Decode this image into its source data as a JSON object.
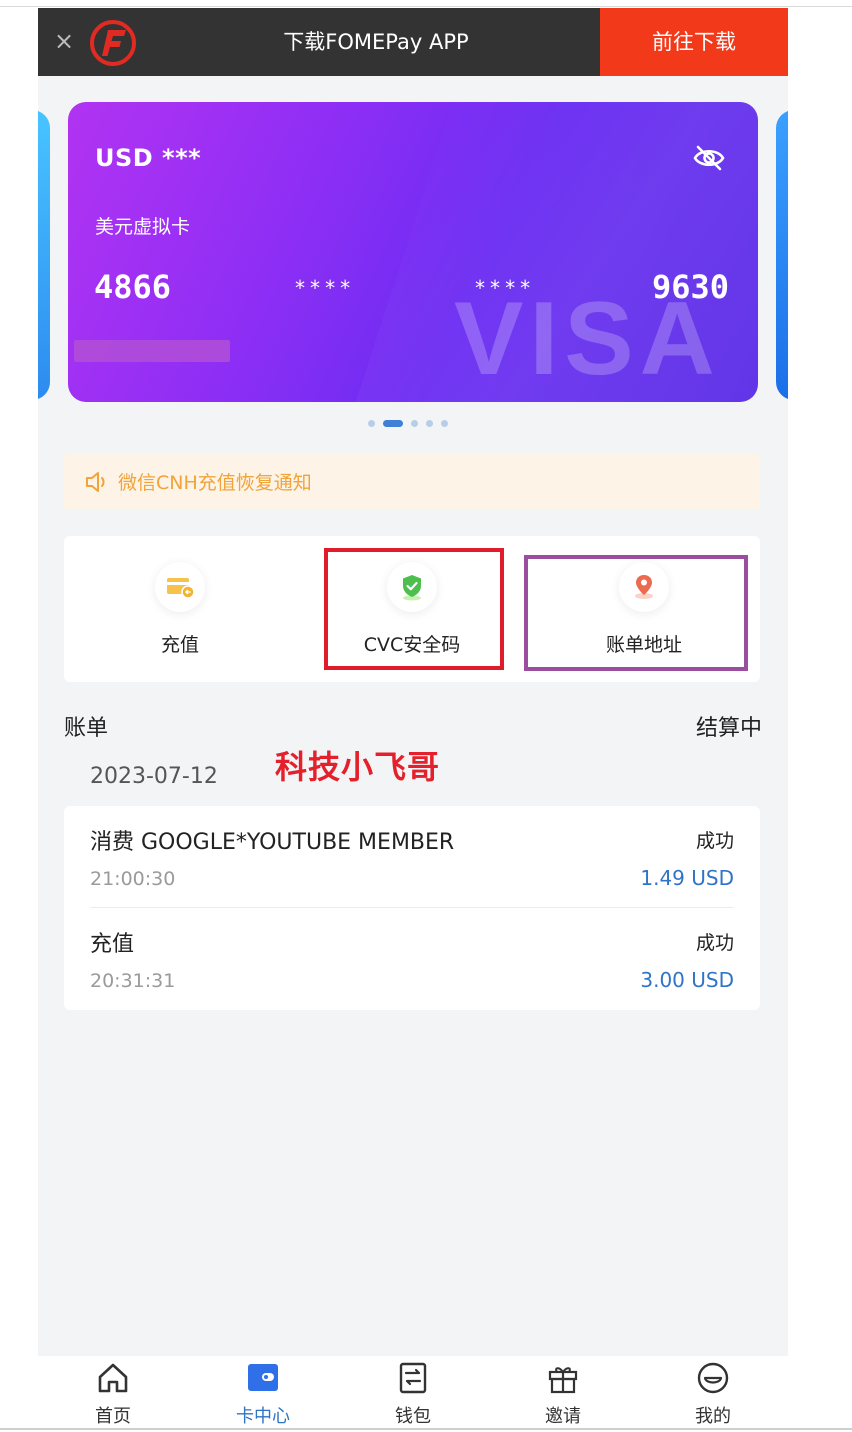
{
  "banner": {
    "close_icon": "close-icon",
    "logo": "fomepay-logo",
    "title": "下载FOMEPay APP",
    "download_button": "前往下载",
    "colors": {
      "bar": "#333333",
      "button": "#f23a1b"
    }
  },
  "card": {
    "currency": "USD ***",
    "visibility_icon": "eye-off-icon",
    "type": "美元虚拟卡",
    "number_groups": [
      "4866",
      "****",
      "****",
      "9630"
    ],
    "brand": "VISA",
    "colors": {
      "start": "#b233f2",
      "end": "#5b2ee6"
    }
  },
  "carousel": {
    "total_slides": 5,
    "active_index": 1
  },
  "notice": {
    "icon": "speaker-icon",
    "text": "微信CNH充值恢复通知",
    "color": "#f0a43a"
  },
  "actions": [
    {
      "label": "充值",
      "icon": "recharge-card-icon"
    },
    {
      "label": "CVC安全码",
      "icon": "shield-check-icon"
    },
    {
      "label": "账单地址",
      "icon": "location-pin-icon"
    }
  ],
  "annotations": {
    "highlight_red": "#e01b2b",
    "highlight_purple": "#9b4d9f",
    "watermark": "科技小飞哥"
  },
  "bills": {
    "title": "账单",
    "status": "结算中",
    "date": "2023-07-12",
    "transactions": [
      {
        "description": "消费 GOOGLE*YOUTUBE MEMBER",
        "time": "21:00:30",
        "state": "成功",
        "amount": "1.49 USD"
      },
      {
        "description": "充值",
        "time": "20:31:31",
        "state": "成功",
        "amount": "3.00 USD"
      }
    ],
    "amount_color": "#2f74c7"
  },
  "tabbar": {
    "active_index": 1,
    "tabs": [
      {
        "label": "首页",
        "icon": "home-icon"
      },
      {
        "label": "卡中心",
        "icon": "wallet-card-icon"
      },
      {
        "label": "钱包",
        "icon": "wallet-icon"
      },
      {
        "label": "邀请",
        "icon": "gift-icon"
      },
      {
        "label": "我的",
        "icon": "smile-face-icon"
      }
    ]
  }
}
